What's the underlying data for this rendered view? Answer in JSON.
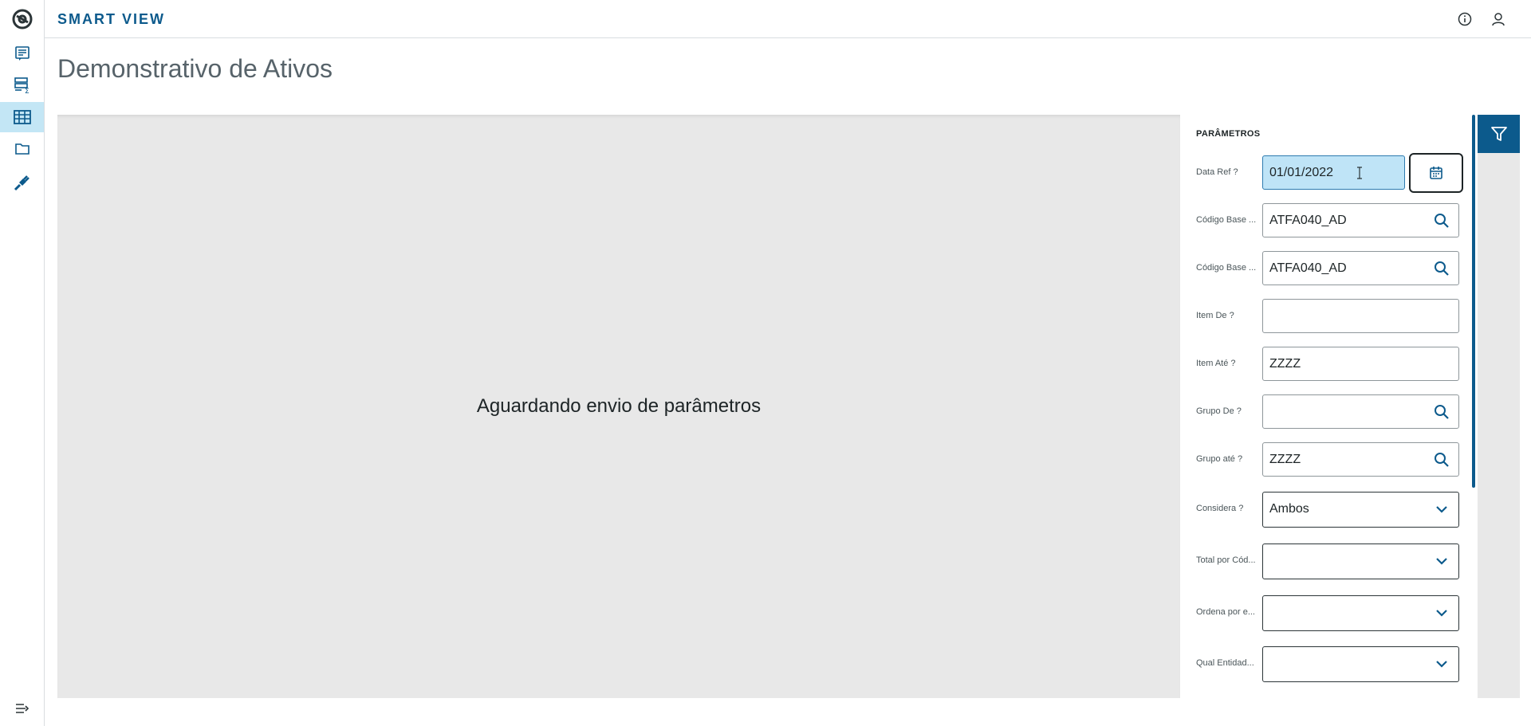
{
  "app": {
    "brand": "SMART VIEW"
  },
  "page": {
    "title": "Demonstrativo de Ativos"
  },
  "viewer": {
    "message": "Aguardando envio de parâmetros"
  },
  "rail": {
    "items": [
      {
        "icon": "report-icon"
      },
      {
        "icon": "data-summary-icon"
      },
      {
        "icon": "table-icon",
        "active": true
      },
      {
        "icon": "folder-icon"
      },
      {
        "icon": "plug-icon"
      }
    ],
    "collapse_icon": "expand-menu-icon"
  },
  "topbar": {
    "info_icon": "info-icon",
    "user_icon": "user-icon"
  },
  "params": {
    "title": "PARÂMETROS",
    "fields": [
      {
        "label": "Data Ref ?",
        "value": "01/01/2022",
        "kind": "date"
      },
      {
        "label": "Código Base ...",
        "value": "ATFA040_AD",
        "kind": "lookup"
      },
      {
        "label": "Código Base ...",
        "value": "ATFA040_AD",
        "kind": "lookup"
      },
      {
        "label": "Item De ?",
        "value": "",
        "kind": "text"
      },
      {
        "label": "Item Até ?",
        "value": "ZZZZ",
        "kind": "text"
      },
      {
        "label": "Grupo De ?",
        "value": "",
        "kind": "lookup"
      },
      {
        "label": "Grupo até ?",
        "value": "ZZZZ",
        "kind": "lookup"
      },
      {
        "label": "Considera ?",
        "value": "Ambos",
        "kind": "select"
      },
      {
        "label": "Total por Cód...",
        "value": "",
        "kind": "select"
      },
      {
        "label": "Ordena por e...",
        "value": "",
        "kind": "select"
      },
      {
        "label": "Qual Entidad...",
        "value": "",
        "kind": "select"
      }
    ]
  },
  "colors": {
    "brand": "#0c5a8c",
    "active_rail": "#c3e6f5",
    "date_highlight": "#bfe4f7",
    "viewer_bg": "#e8e8e8"
  }
}
